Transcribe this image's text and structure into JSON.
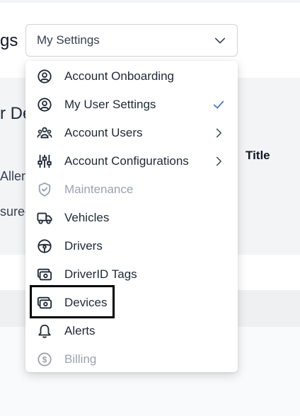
{
  "page": {
    "title_fragment": "gs",
    "section_fragment": "r De",
    "row1_fragment": "Allen",
    "row2_fragment": "sured",
    "column_title": "Title"
  },
  "selector": {
    "value": "My Settings",
    "icon": "chevron-down-icon"
  },
  "menu": {
    "items": [
      {
        "label": "Account Onboarding",
        "icon": "user-circle-icon",
        "disabled": false,
        "trailing": ""
      },
      {
        "label": "My User Settings",
        "icon": "user-circle-icon",
        "disabled": false,
        "trailing": "check-icon"
      },
      {
        "label": "Account Users",
        "icon": "users-icon",
        "disabled": false,
        "trailing": "chevron-right-icon"
      },
      {
        "label": "Account Configurations",
        "icon": "sliders-icon",
        "disabled": false,
        "trailing": "chevron-right-icon"
      },
      {
        "label": "Maintenance",
        "icon": "shield-check-icon",
        "disabled": true,
        "trailing": ""
      },
      {
        "label": "Vehicles",
        "icon": "truck-icon",
        "disabled": false,
        "trailing": ""
      },
      {
        "label": "Drivers",
        "icon": "steering-wheel-icon",
        "disabled": false,
        "trailing": ""
      },
      {
        "label": "DriverID Tags",
        "icon": "tag-device-icon",
        "disabled": false,
        "trailing": ""
      },
      {
        "label": "Devices",
        "icon": "device-icon",
        "disabled": false,
        "trailing": ""
      },
      {
        "label": "Alerts",
        "icon": "bell-icon",
        "disabled": false,
        "trailing": ""
      },
      {
        "label": "Billing",
        "icon": "dollar-circle-icon",
        "disabled": true,
        "trailing": ""
      }
    ]
  },
  "colors": {
    "accent": "#4b7bbf",
    "disabled": "#9ca3af",
    "text": "#1f2937",
    "highlight": "#000000"
  }
}
